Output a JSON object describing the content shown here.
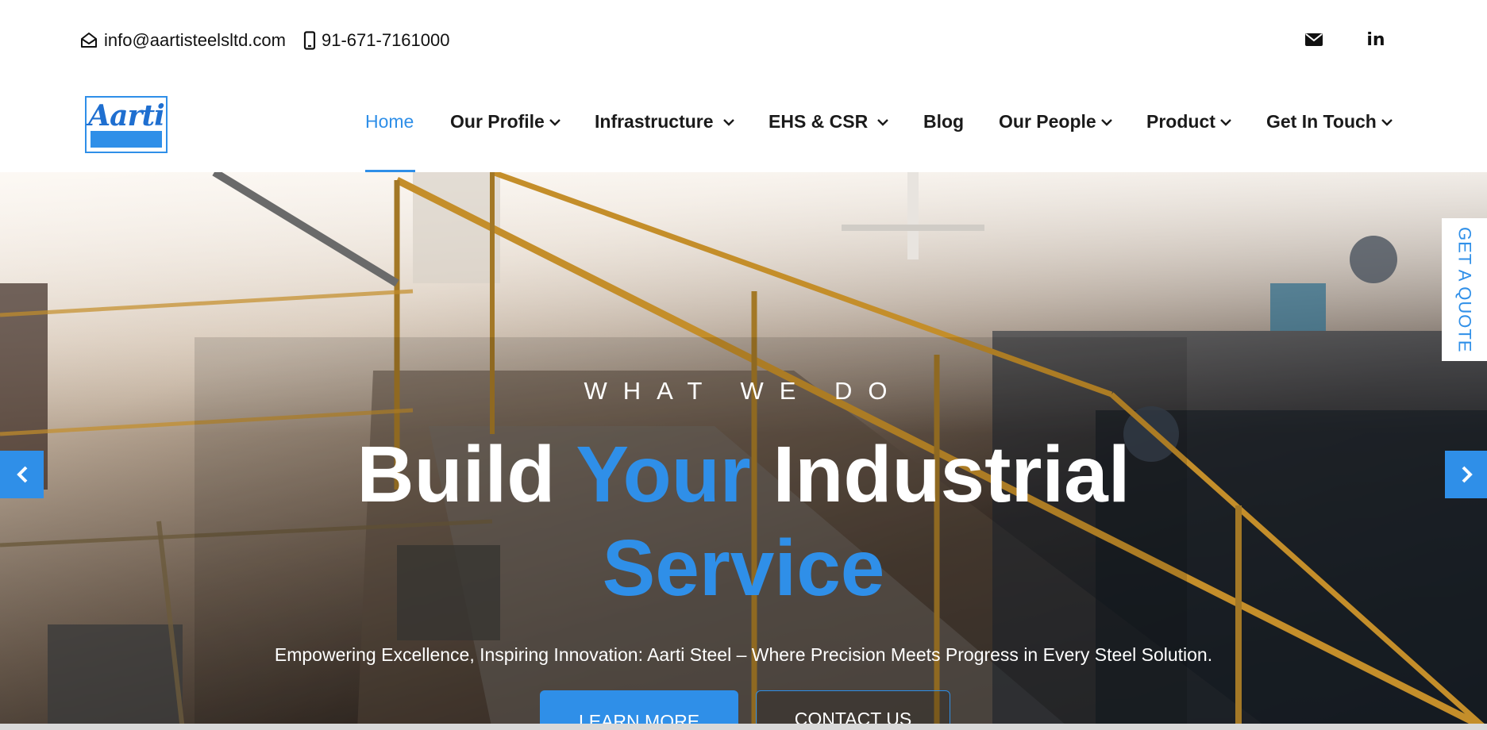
{
  "topbar": {
    "email": "info@aartisteelsltd.com",
    "phone": "91-671-7161000",
    "email_icon": "envelope-open-icon",
    "phone_icon": "mobile-phone-icon",
    "social": [
      {
        "name": "mail",
        "icon": "envelope-icon"
      },
      {
        "name": "linkedin",
        "icon": "linkedin-icon",
        "glyph": "in"
      }
    ]
  },
  "logo": {
    "text": "Aarti"
  },
  "nav": {
    "items": [
      {
        "label": "Home",
        "active": true,
        "dropdown": false
      },
      {
        "label": "Our Profile",
        "dropdown": true
      },
      {
        "label": "Infrastructure",
        "dropdown": true
      },
      {
        "label": "EHS & CSR",
        "dropdown": true
      },
      {
        "label": "Blog",
        "dropdown": false
      },
      {
        "label": "Our People",
        "dropdown": true
      },
      {
        "label": "Product",
        "dropdown": true
      },
      {
        "label": "Get In Touch",
        "dropdown": true
      }
    ]
  },
  "hero": {
    "eyebrow": "WHAT WE DO",
    "headline": {
      "part1": "Build ",
      "accent": "Your",
      "part2": " Industrial",
      "line2": "Service"
    },
    "subtitle": "Empowering Excellence, Inspiring Innovation: Aarti Steel – Where Precision Meets Progress in Every Steel Solution.",
    "buttons": {
      "learn_more": "LEARN MORE",
      "contact_us": "CONTACT US"
    },
    "prev_icon": "chevron-left-icon",
    "next_icon": "chevron-right-icon"
  },
  "quote_tab": {
    "label": "GET A QUOTE"
  },
  "colors": {
    "accent": "#2f8fe8",
    "text": "#1a1a1a",
    "white": "#ffffff"
  }
}
